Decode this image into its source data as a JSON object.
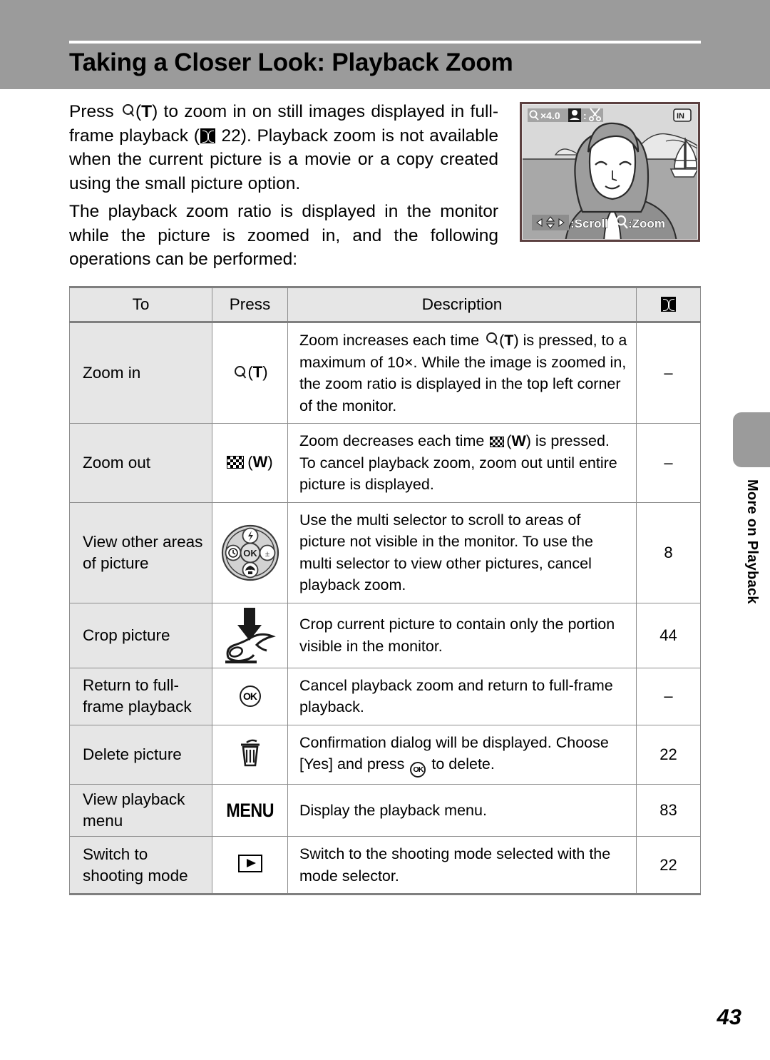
{
  "header": {
    "title": "Taking a Closer Look: Playback Zoom"
  },
  "intro": {
    "para1_a": "Press",
    "para1_b": "(",
    "para1_c": ") to zoom in on still images displayed in full-frame playback (",
    "para1_d": "22). Playback zoom is not available when the current picture is a movie or a copy created using the small picture option.",
    "para1_t": "T",
    "para2": "The playback zoom ratio is displayed in the monitor while the picture is zoomed in, and the following operations can be performed:"
  },
  "monitor": {
    "zoom_ratio": "×4.0",
    "crop_hint_sep": ":",
    "in_badge": "IN",
    "scroll_hint": ":Scroll",
    "zoom_hint": ":Zoom",
    "icons": {
      "magnifier": "magnifier-icon",
      "shutter": "shutter-button-icon",
      "scissors": "scissors-crop-icon",
      "multi_selector": "multi-selector-arrows-icon",
      "internal_memory": "internal-memory-icon"
    }
  },
  "table": {
    "headers": {
      "to": "To",
      "press": "Press",
      "description": "Description",
      "reference": "book-reference-icon"
    },
    "rows": [
      {
        "to": "Zoom in",
        "press_text": "(T)",
        "press_icon": "magnifier-icon",
        "desc_a": "Zoom increases each time",
        "desc_t": "T",
        "desc_b": "is pressed, to a maximum of 10×. While the image is zoomed in, the zoom ratio is displayed in the top left corner of the monitor.",
        "ref": "–"
      },
      {
        "to": "Zoom out",
        "press_text": "(W)",
        "press_icon": "checkerboard-wide-icon",
        "desc_a": "Zoom decreases each time",
        "desc_t": "W",
        "desc_b": "is pressed. To cancel playback zoom, zoom out until entire picture is displayed.",
        "ref": "–"
      },
      {
        "to": "View other areas of picture",
        "press_icon": "multi-selector-icon",
        "desc": "Use the multi selector to scroll to areas of picture not visible in the monitor. To use the multi selector to view other pictures, cancel playback zoom.",
        "ref": "8"
      },
      {
        "to": "Crop picture",
        "press_icon": "shutter-press-hand-icon",
        "desc": "Crop current picture to contain only the portion visible in the monitor.",
        "ref": "44"
      },
      {
        "to": "Return to full-frame playback",
        "press_icon": "ok-button-icon",
        "press_text": "OK",
        "desc": "Cancel playback zoom and return to full-frame playback.",
        "ref": "–"
      },
      {
        "to": "Delete picture",
        "press_icon": "trash-icon",
        "desc_a": "Confirmation dialog will be displayed. Choose [Yes] and press",
        "desc_ok": "OK",
        "desc_b": "to delete.",
        "ref": "22"
      },
      {
        "to": "View playback menu",
        "press_icon": "menu-button-icon",
        "press_text": "MENU",
        "desc": "Display the playback menu.",
        "ref": "83"
      },
      {
        "to": "Switch to shooting mode",
        "press_icon": "playback-button-icon",
        "desc": "Switch to the shooting mode selected with the mode selector.",
        "ref": "22"
      }
    ]
  },
  "side_tab": {
    "label": "More on Playback"
  },
  "footer": {
    "page_number": "43"
  },
  "colors": {
    "header_band": "#9b9b9b",
    "table_head_fill": "#e6e6e6",
    "table_border": "#8d8d8d",
    "monitor_frame": "#5c4040"
  }
}
